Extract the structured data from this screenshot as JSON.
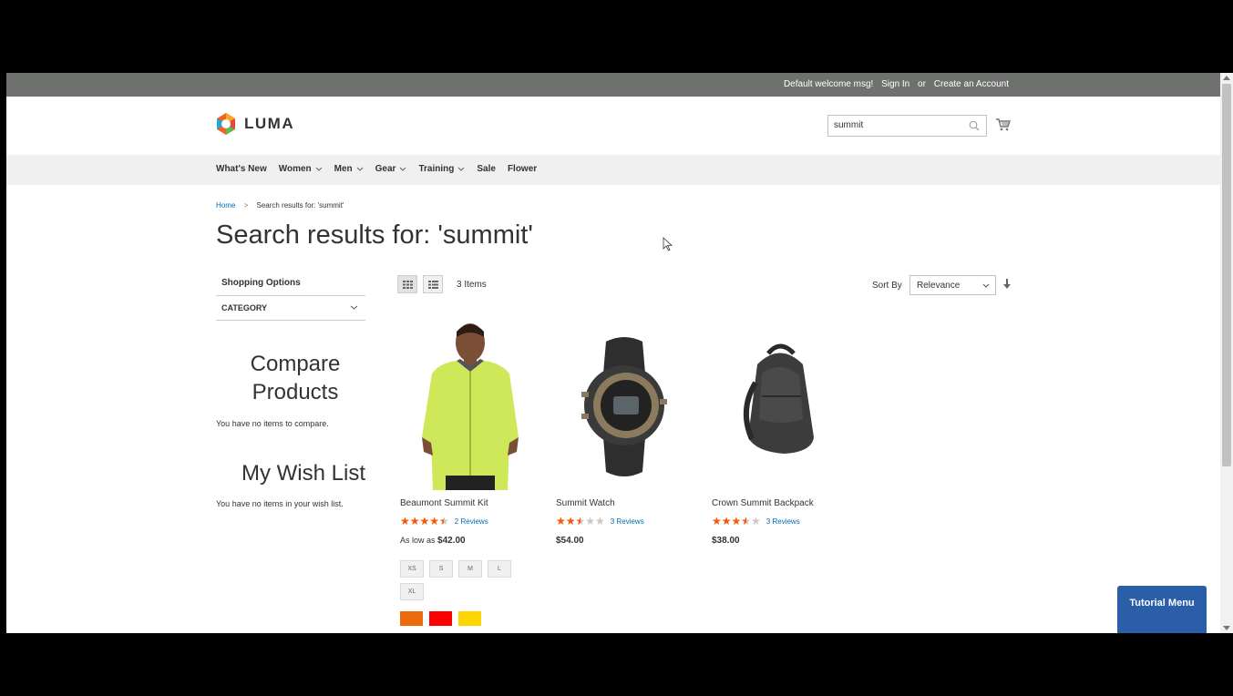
{
  "topbar": {
    "welcome": "Default welcome msg!",
    "sign_in": "Sign In",
    "or": "or",
    "create_account": "Create an Account"
  },
  "header": {
    "brand": "LUMA",
    "search_value": "summit",
    "cart_icon": "cart-icon",
    "search_icon": "search-icon"
  },
  "nav": {
    "items": [
      {
        "label": "What's New",
        "has_dropdown": false
      },
      {
        "label": "Women",
        "has_dropdown": true
      },
      {
        "label": "Men",
        "has_dropdown": true
      },
      {
        "label": "Gear",
        "has_dropdown": true
      },
      {
        "label": "Training",
        "has_dropdown": true
      },
      {
        "label": "Sale",
        "has_dropdown": false
      },
      {
        "label": "Flower",
        "has_dropdown": false
      }
    ]
  },
  "breadcrumb": {
    "home": "Home",
    "separator": ">",
    "current": "Search results for: 'summit'"
  },
  "page_title": "Search results for: 'summit'",
  "sidebar": {
    "shopping_options": "Shopping Options",
    "category": "CATEGORY",
    "compare_title": "Compare Products",
    "compare_empty": "You have no items to compare.",
    "wish_title": "My Wish List",
    "wish_empty": "You have no items in your wish list."
  },
  "toolbar": {
    "item_count": "3 Items",
    "sort_label": "Sort By",
    "sort_value": "Relevance"
  },
  "products": [
    {
      "name": "Beaumont Summit Kit",
      "rating_percent": 90,
      "reviews": "2 Reviews",
      "price_prefix": "As low as",
      "price": "$42.00",
      "sizes": [
        "XS",
        "S",
        "M",
        "L",
        "XL"
      ],
      "colors": [
        "#ec6a0b",
        "#ff0000",
        "#ffd500"
      ]
    },
    {
      "name": "Summit Watch",
      "rating_percent": 50,
      "reviews": "3 Reviews",
      "price_prefix": "",
      "price": "$54.00"
    },
    {
      "name": "Crown Summit Backpack",
      "rating_percent": 70,
      "reviews": "3 Reviews",
      "price_prefix": "",
      "price": "$38.00"
    }
  ],
  "tutorial_menu": "Tutorial Menu",
  "colors": {
    "topbar_bg": "#6e716e",
    "nav_bg": "#f0f0f0",
    "link": "#006bb4",
    "star": "#ff5501",
    "tutorial_bg": "#2a5ea8"
  }
}
